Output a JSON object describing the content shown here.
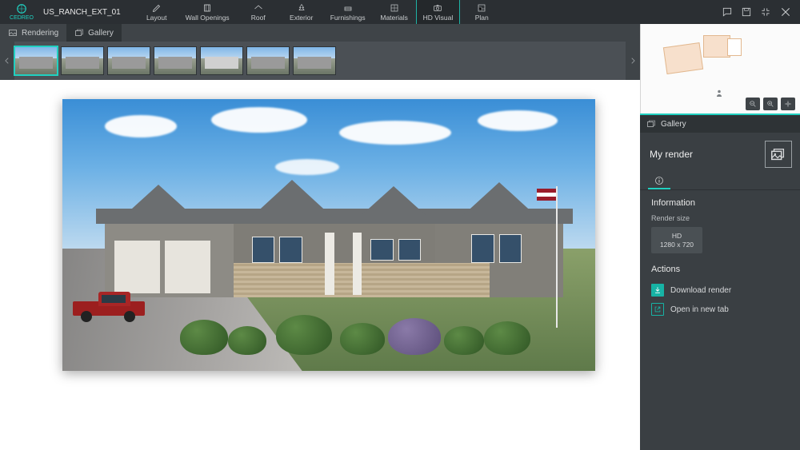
{
  "app": {
    "brand": "CEDREO",
    "project": "US_RANCH_EXT_01"
  },
  "topTools": [
    {
      "id": "layout",
      "label": "Layout"
    },
    {
      "id": "wall-openings",
      "label": "Wall Openings"
    },
    {
      "id": "roof",
      "label": "Roof"
    },
    {
      "id": "exterior",
      "label": "Exterior"
    },
    {
      "id": "furnishings",
      "label": "Furnishings"
    },
    {
      "id": "materials",
      "label": "Materials"
    },
    {
      "id": "hd-visual",
      "label": "HD Visual",
      "active": true
    },
    {
      "id": "plan",
      "label": "Plan"
    }
  ],
  "secondbar": {
    "rendering": "Rendering",
    "gallery": "Gallery"
  },
  "sidepanel": {
    "head": "Gallery",
    "title": "My render",
    "info_h": "Information",
    "render_size_label": "Render size",
    "size_name": "HD",
    "size_value": "1280 x 720",
    "actions_h": "Actions",
    "download": "Download render",
    "open_new_tab": "Open in new tab"
  }
}
